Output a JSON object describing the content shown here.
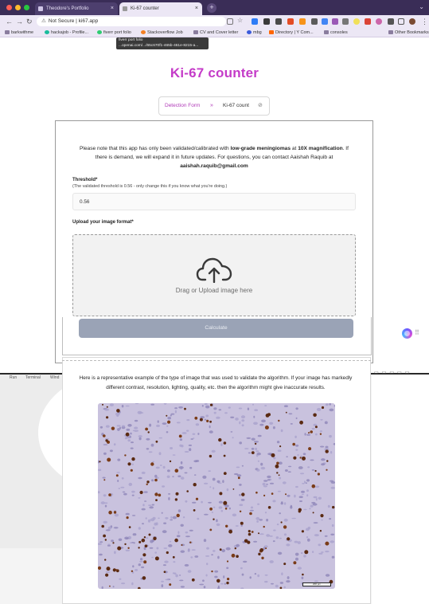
{
  "browser": {
    "tabs": [
      {
        "title": "Theodore's Portfolio",
        "active": false
      },
      {
        "title": "Ki-67 counter",
        "active": true
      }
    ],
    "address": {
      "security": "Not Secure",
      "url": "ki67.app"
    },
    "bookmarks": [
      "barkwithme",
      "hackajob - Profile...",
      "fiverr port folio",
      "Stackoverflow Job",
      "CV and Cover letter",
      "mbg",
      "Directory | Y Com...",
      "consoles",
      "Other Bookmarks"
    ],
    "tooltip": {
      "line1": "fiverr port folio",
      "line2": "...openai.com/.../65c670f1-465b-461e-8215-a..."
    }
  },
  "page": {
    "title": "Ki-67 counter",
    "steps": {
      "step1": "Detection Form",
      "step2": "Ki-67 count"
    },
    "notice": {
      "part1": "Please note that this app has only been validated/calibrated with ",
      "bold1": "low-grade meningiomas",
      "part2": " at ",
      "bold2": "10X magnification",
      "part3": ". If there is demand, we will expand it in future updates. For questions, you can contact Aaishah Raquib at ",
      "email": "aaishah.raquib@gmail.com"
    },
    "threshold": {
      "label": "Threshold*",
      "help": "(The validated threshold is 0.56 - only change this if you know what you're doing.)",
      "value": "0.56"
    },
    "upload": {
      "label": "Upload your image format*",
      "dropzone_text": "Drag or Upload image here"
    },
    "calculate_label": "Calculate",
    "example": {
      "text": "Here is a representative example of the type of image that was used to validate the algorithm. If your image has markedly different contrast, resolution, lighting, quality, etc. then the algorithm might give inaccurate results.",
      "scale_label": "200 µm"
    }
  },
  "lower_window": {
    "menu": [
      "Run",
      "Terminal",
      "Wind"
    ]
  },
  "colors": {
    "accent": "#c43bc8",
    "button": "#9aa3b6",
    "tab_bar": "#3a2d57"
  }
}
